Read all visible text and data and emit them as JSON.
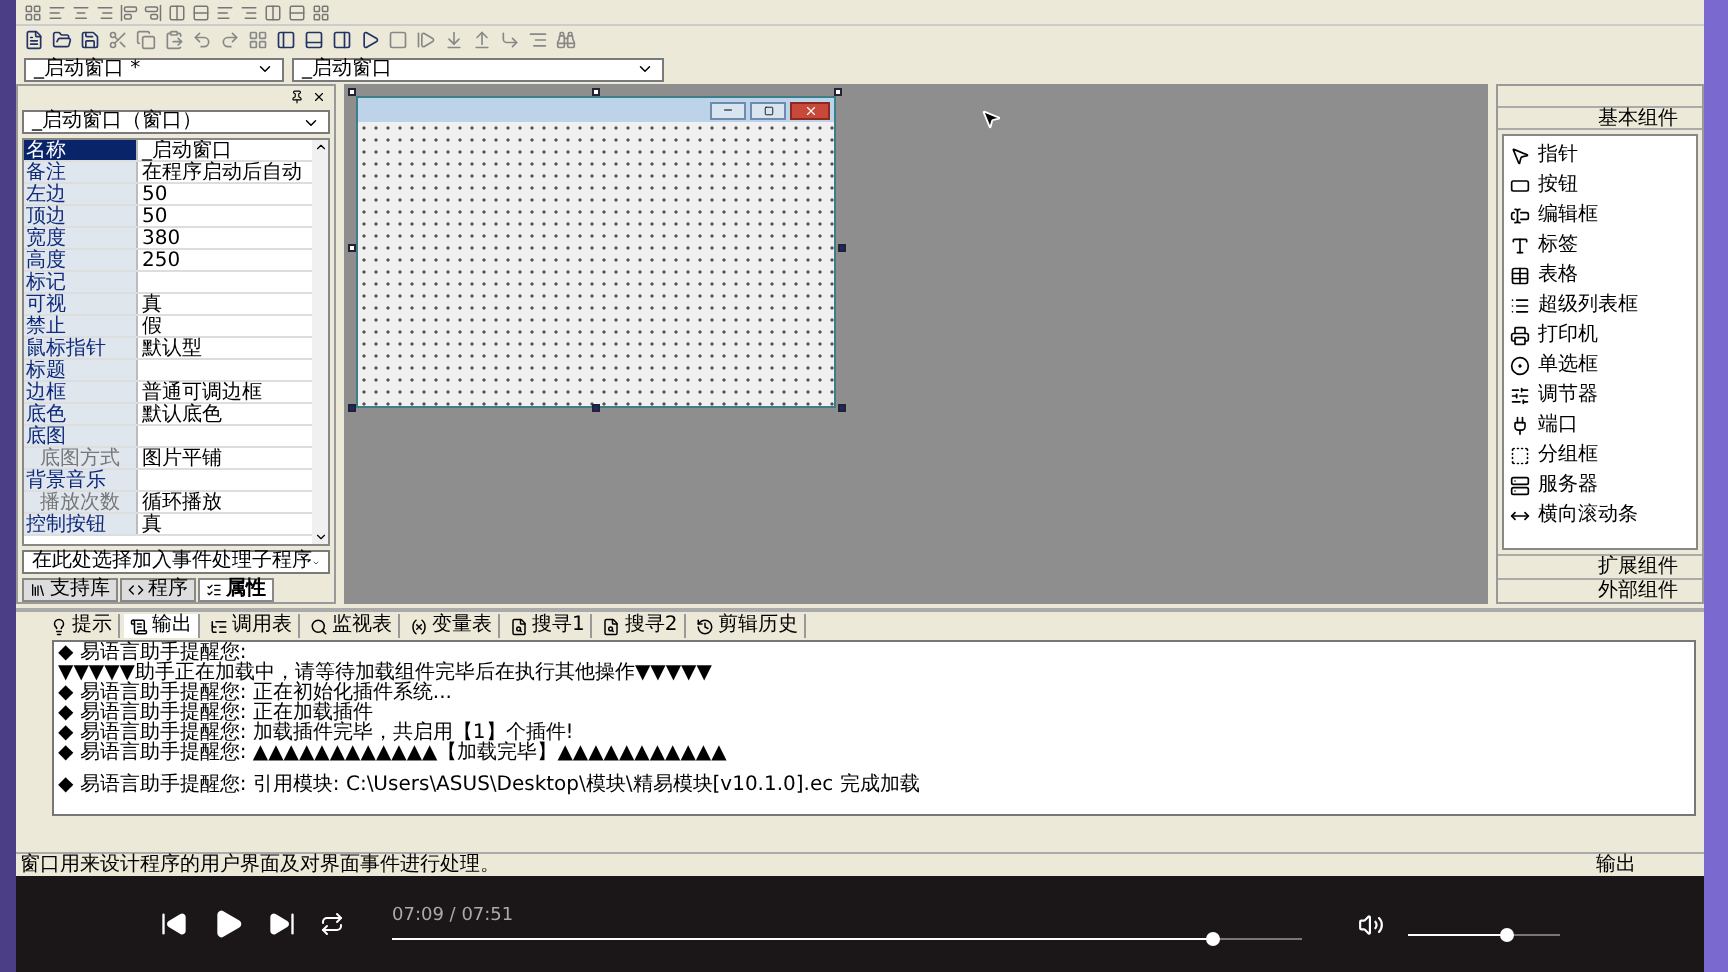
{
  "selectors": [
    {
      "value": "_启动窗口 *"
    },
    {
      "value": "_启动窗口"
    }
  ],
  "properties": {
    "object": "_启动窗口（窗口）",
    "rows": [
      {
        "name": "名称",
        "value": "_启动窗口",
        "selected": true,
        "indented": false
      },
      {
        "name": "备注",
        "value": "在程序启动后自动",
        "selected": false,
        "indented": false
      },
      {
        "name": "左边",
        "value": "50",
        "selected": false,
        "indented": false
      },
      {
        "name": "顶边",
        "value": "50",
        "selected": false,
        "indented": false
      },
      {
        "name": "宽度",
        "value": "380",
        "selected": false,
        "indented": false
      },
      {
        "name": "高度",
        "value": "250",
        "selected": false,
        "indented": false
      },
      {
        "name": "标记",
        "selected": false,
        "indented": false
      },
      {
        "name": "可视",
        "value": "真",
        "selected": false,
        "indented": false
      },
      {
        "name": "禁止",
        "value": "假",
        "selected": false,
        "indented": false
      },
      {
        "name": "鼠标指针",
        "value": "默认型",
        "selected": false,
        "indented": false
      },
      {
        "name": "标题",
        "selected": false,
        "indented": false
      },
      {
        "name": "边框",
        "value": "普通可调边框",
        "selected": false,
        "indented": false
      },
      {
        "name": "底色",
        "value": "默认底色",
        "selected": false,
        "indented": false
      },
      {
        "name": "底图",
        "selected": false,
        "indented": false
      },
      {
        "name": "底图方式",
        "value": "图片平铺",
        "selected": false,
        "indented": true
      },
      {
        "name": "背景音乐",
        "selected": false,
        "indented": false
      },
      {
        "name": "播放次数",
        "value": "循环播放",
        "selected": false,
        "indented": true
      },
      {
        "name": "控制按钮",
        "value": "真",
        "selected": false,
        "indented": false
      }
    ],
    "event_selector": "在此处选择加入事件处理子程序"
  },
  "panel_tabs": [
    {
      "label": "支持库",
      "selected": false
    },
    {
      "label": "程序",
      "selected": false
    },
    {
      "label": "属性",
      "selected": true
    }
  ],
  "components": {
    "header": "基本组件",
    "items": [
      "指针",
      "按钮",
      "编辑框",
      "标签",
      "表格",
      "超级列表框",
      "打印机",
      "单选框",
      "调节器",
      "端口",
      "分组框",
      "服务器",
      "横向滚动条"
    ],
    "sections": [
      "扩展组件",
      "外部组件"
    ]
  },
  "output_tabs": [
    {
      "label": "提示",
      "selected": false
    },
    {
      "label": "输出",
      "selected": true
    },
    {
      "label": "调用表",
      "selected": false
    },
    {
      "label": "监视表",
      "selected": false
    },
    {
      "label": "变量表",
      "selected": false
    },
    {
      "label": "搜寻1",
      "selected": false
    },
    {
      "label": "搜寻2",
      "selected": false
    },
    {
      "label": "剪辑历史",
      "selected": false
    }
  ],
  "output_lines": [
    {
      "text": "◆ 易语言助手提醒您:",
      "spaced": false
    },
    {
      "text": "▼▼▼▼▼助手正在加载中，请等待加载组件完毕后在执行其他操作▼▼▼▼▼",
      "spaced": false
    },
    {
      "text": "◆ 易语言助手提醒您: 正在初始化插件系统...",
      "spaced": false
    },
    {
      "text": "◆ 易语言助手提醒您: 正在加载插件",
      "spaced": false
    },
    {
      "text": "◆ 易语言助手提醒您: 加载插件完毕，共启用【1】个插件!",
      "spaced": false
    },
    {
      "text": "◆ 易语言助手提醒您: ▲▲▲▲▲▲▲▲▲▲▲▲【加载完毕】▲▲▲▲▲▲▲▲▲▲▲",
      "spaced": false
    },
    {
      "text": "◆ 易语言助手提醒您: 引用模块: C:\\Users\\ASUS\\Desktop\\模块\\精易模块[v10.1.0].ec 完成加载",
      "spaced": true
    }
  ],
  "status_bar": {
    "text": "窗口用来设计程序的用户界面及对界面事件进行处理。",
    "right": "输出"
  },
  "player": {
    "time": "07:09 / 07:51",
    "progress": {
      "level": 0.9
    },
    "volume": {
      "level": 0.64
    }
  }
}
